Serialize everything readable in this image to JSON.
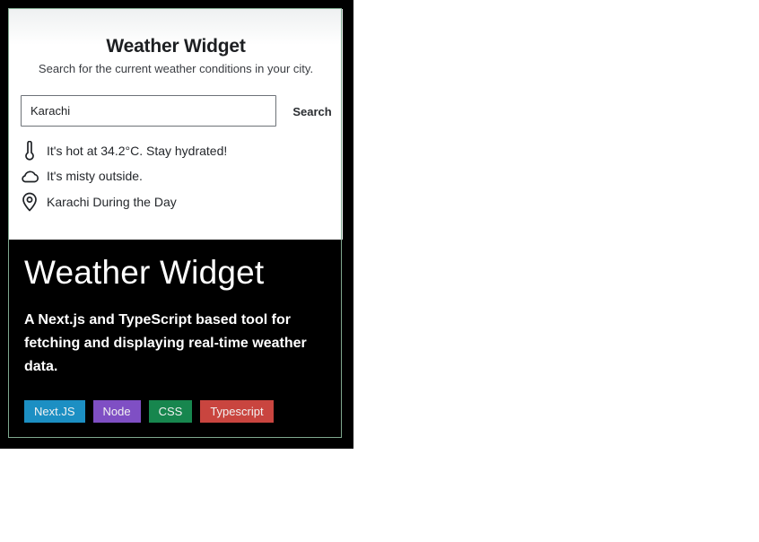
{
  "widget": {
    "title": "Weather Widget",
    "subtitle": "Search for the current weather conditions in your city.",
    "search": {
      "value": "Karachi",
      "placeholder": "",
      "button_label": "Search"
    },
    "results": {
      "temperature": "It's hot at 34.2°C. Stay hydrated!",
      "condition": "It's misty outside.",
      "location": "Karachi During the Day"
    },
    "icons": {
      "temperature": "thermometer-icon",
      "condition": "cloud-icon",
      "location": "map-pin-icon"
    }
  },
  "project": {
    "title": "Weather Widget",
    "description": "A Next.js and TypeScript based tool for fetching and displaying real-time weather data.",
    "tags": [
      {
        "label": "Next.JS",
        "color": "#1c8fc3"
      },
      {
        "label": "Node",
        "color": "#7f4fc4"
      },
      {
        "label": "CSS",
        "color": "#17864e"
      },
      {
        "label": "Typescript",
        "color": "#c9453f"
      }
    ]
  }
}
